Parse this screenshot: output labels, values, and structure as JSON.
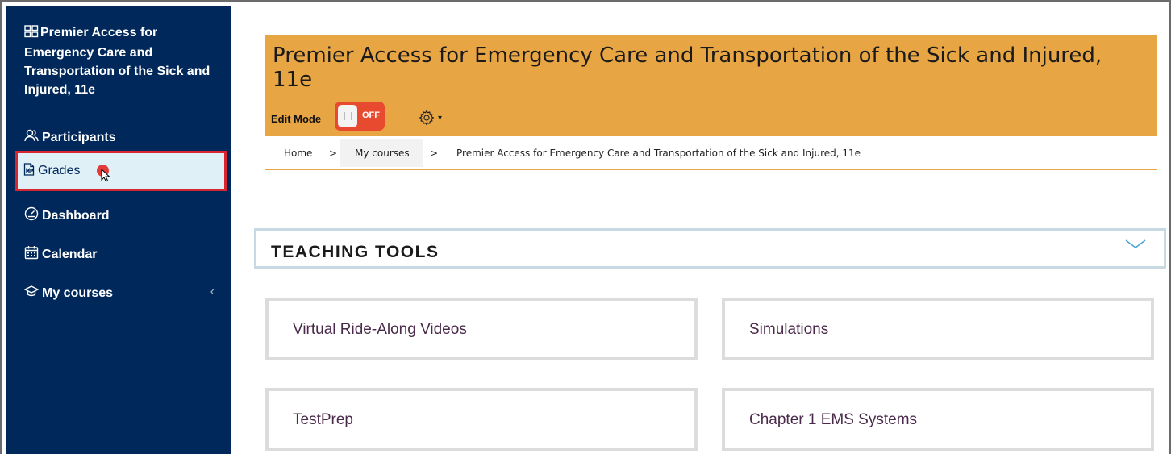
{
  "sidebar": {
    "course_title": "Premier Access for Emergency Care and Transportation of the Sick and Injured, 11e",
    "items": {
      "participants": "Participants",
      "grades": "Grades",
      "dashboard": "Dashboard",
      "calendar": "Calendar",
      "my_courses": "My courses"
    }
  },
  "header": {
    "title": "Premier Access for Emergency Care and Transportation of the Sick and Injured, 11e",
    "edit_mode_label": "Edit Mode",
    "toggle_state": "OFF"
  },
  "breadcrumb": {
    "home": "Home",
    "separator": ">",
    "my_courses": "My courses",
    "course": "Premier Access for Emergency Care and Transportation of the Sick and Injured, 11e"
  },
  "section": {
    "title": "TEACHING TOOLS"
  },
  "cards": [
    {
      "label": "Virtual Ride-Along Videos"
    },
    {
      "label": "Simulations"
    },
    {
      "label": "TestPrep"
    },
    {
      "label": "Chapter 1 EMS Systems"
    }
  ],
  "colors": {
    "sidebar_bg": "#00285a",
    "header_bg": "#e8a543",
    "toggle_off": "#e84a2f",
    "highlight_border": "#d7262f"
  }
}
